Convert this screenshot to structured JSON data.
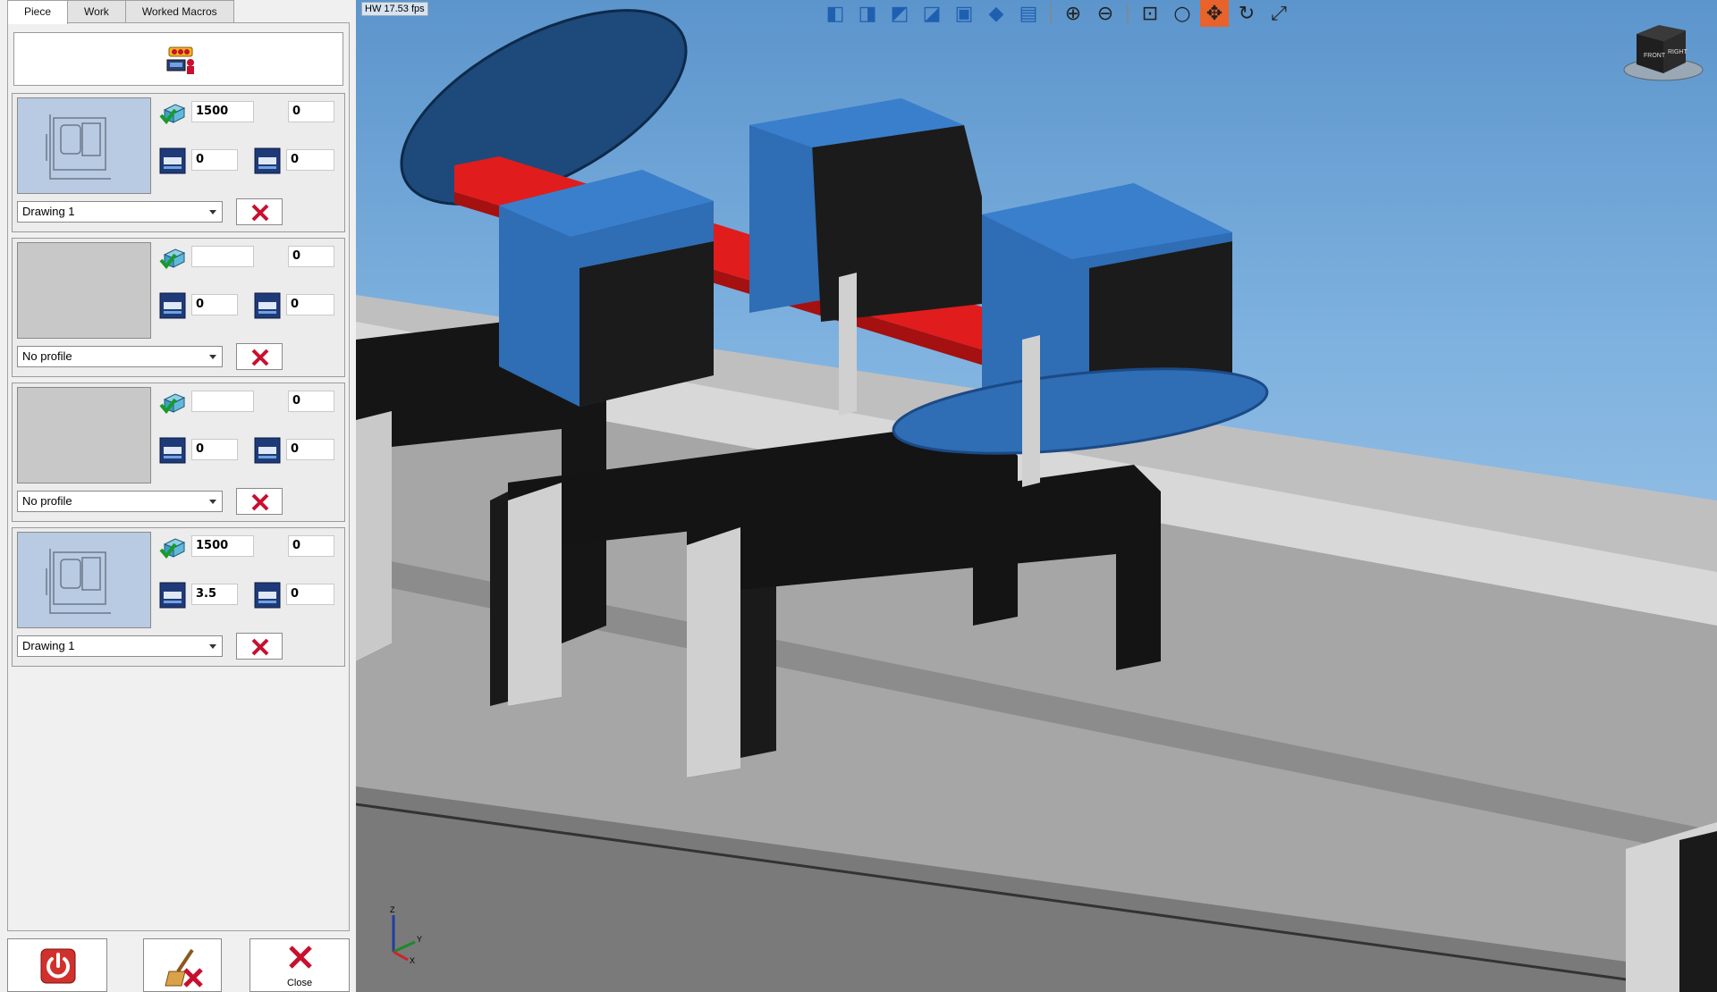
{
  "tabs": [
    {
      "label": "Piece",
      "active": true
    },
    {
      "label": "Work",
      "active": false
    },
    {
      "label": "Worked Macros",
      "active": false
    }
  ],
  "pieces": [
    {
      "thumbnail": "drawing",
      "length": "1500",
      "count": "0",
      "left_offset": "0",
      "right_offset": "0",
      "profile": "Drawing 1"
    },
    {
      "thumbnail": "empty",
      "length": "",
      "count": "0",
      "left_offset": "0",
      "right_offset": "0",
      "profile": "No profile"
    },
    {
      "thumbnail": "empty",
      "length": "",
      "count": "0",
      "left_offset": "0",
      "right_offset": "0",
      "profile": "No profile"
    },
    {
      "thumbnail": "drawing",
      "length": "1500",
      "count": "0",
      "left_offset": "3.5",
      "right_offset": "0",
      "profile": "Drawing 1"
    }
  ],
  "bottom_buttons": {
    "power_icon": "power-icon",
    "clear_icon": "broom-clear-icon",
    "close_label": "Close"
  },
  "viewport": {
    "fps": "HW 17.53 fps",
    "toolbar_icons": [
      "view-front-icon",
      "view-left-icon",
      "view-right-icon",
      "view-top-icon",
      "view-back-icon",
      "view-iso-icon",
      "screenshot-jpg-icon",
      "zoom-in-icon",
      "zoom-out-icon",
      "zoom-window-icon",
      "zoom-icon",
      "pan-icon",
      "rotate-icon",
      "fit-all-icon"
    ],
    "active_tool": "pan-icon",
    "view_cube": {
      "front": "FRONT",
      "right": "RIGHT"
    },
    "axes": {
      "z": "Z",
      "y": "Y",
      "x": "X"
    }
  },
  "colors": {
    "accent": "#e8632c",
    "machine_blue": "#2f6db5",
    "profile_red": "#e11c1c",
    "delete_red": "#c8102e"
  }
}
